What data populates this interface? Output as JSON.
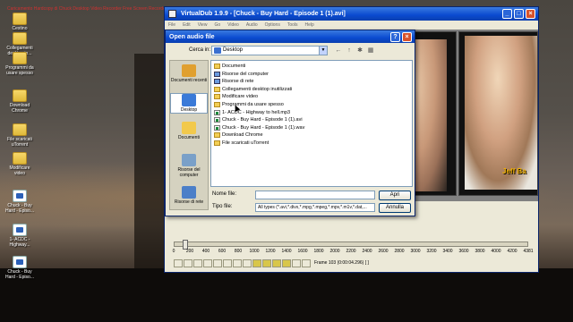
{
  "desktop": {
    "scroll_text": "Caricamento Hardcopy di Chuck Desktop Video Recorder Free Screen Recorder 1.0 Trial",
    "icons": [
      {
        "label": "Cestino",
        "type": "folder"
      },
      {
        "label": "Collegamenti desktop in...",
        "type": "folder"
      },
      {
        "label": "Programmi da usare spesso",
        "type": "folder"
      },
      {
        "label": "Download Chrome",
        "type": "folder"
      },
      {
        "label": "File scaricati uTorrent",
        "type": "folder"
      },
      {
        "label": "Modificare video",
        "type": "folder"
      },
      {
        "label": "Chuck - Buy Hard - Episo...",
        "type": "file"
      },
      {
        "label": "1- ACDC - Highway...",
        "type": "file"
      },
      {
        "label": "Chuck - Buy Hard - Episo...",
        "type": "file"
      }
    ]
  },
  "virtualdub": {
    "title": "VirtualDub 1.9.9 - [Chuck - Buy Hard - Episode 1 (1).avi]",
    "menu": [
      "File",
      "Edit",
      "View",
      "Go",
      "Video",
      "Audio",
      "Options",
      "Tools",
      "Help"
    ],
    "caption": "Jeff Ba",
    "timeline_ticks": [
      "0",
      "200",
      "400",
      "600",
      "800",
      "1000",
      "1200",
      "1400",
      "1600",
      "1800",
      "2000",
      "2200",
      "2400",
      "2600",
      "2800",
      "3000",
      "3200",
      "3400",
      "3600",
      "3800",
      "4000",
      "4200",
      "4381"
    ],
    "frame_status": "Frame 103 (0:00:04.296) [ ]",
    "position_fraction": 0.0235,
    "window_buttons": {
      "minimize": "_",
      "maximize": "□",
      "close": "×"
    }
  },
  "dialog": {
    "title": "Open audio file",
    "help": "?",
    "close": "×",
    "look_in_label": "Cerca in:",
    "look_in_value": "Desktop",
    "nav": {
      "back": "←",
      "up": "↑",
      "new_folder": "✱",
      "view": "▦"
    },
    "places": [
      {
        "label": "Documenti recenti",
        "color": "#e0a030"
      },
      {
        "label": "Desktop",
        "color": "#3a7ad8"
      },
      {
        "label": "Documenti",
        "color": "#f2c94c"
      },
      {
        "label": "Risorse del computer",
        "color": "#7aa0c8"
      },
      {
        "label": "Risorse di rete",
        "color": "#4c7fc8"
      }
    ],
    "files": [
      {
        "name": "Documenti",
        "kind": "folder"
      },
      {
        "name": "Risorse del computer",
        "kind": "sys"
      },
      {
        "name": "Risorse di rete",
        "kind": "sys"
      },
      {
        "name": "Collegamenti desktop inutilizzati",
        "kind": "folder"
      },
      {
        "name": "Modificare video",
        "kind": "folder"
      },
      {
        "name": "Programmi da usare spesso",
        "kind": "folder"
      },
      {
        "name": "1- ACDC - Highway to hell.mp3",
        "kind": "media"
      },
      {
        "name": "Chuck - Buy Hard - Episode 1 (1).avi",
        "kind": "media"
      },
      {
        "name": "Chuck - Buy Hard - Episode 1 (1).wav",
        "kind": "media"
      },
      {
        "name": "Download Chrome",
        "kind": "folder"
      },
      {
        "name": "File scaricati uTorrent",
        "kind": "folder"
      }
    ],
    "filename_label": "Nome file:",
    "filename_value": "",
    "filetype_label": "Tipo file:",
    "filetype_value": "All types (*.avi,*.divx,*.mpg,*.mpeg,*.mpv,*.m1v,*.dat,...",
    "open_button": "Apri",
    "cancel_button": "Annulla"
  }
}
